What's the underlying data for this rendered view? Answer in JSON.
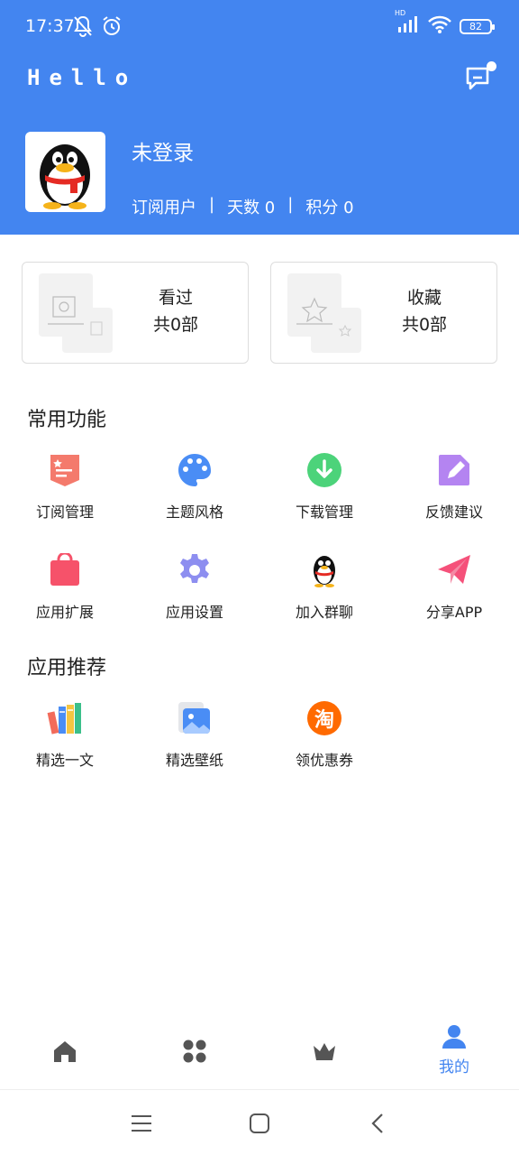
{
  "status_bar": {
    "time": "17:37",
    "network_badge": "HD",
    "battery": "82",
    "icons": [
      "mute-icon",
      "alarm-icon",
      "signal-icon",
      "wifi-icon",
      "battery-icon"
    ]
  },
  "header": {
    "app_title": "Hello",
    "message_icon": "message-icon",
    "bg_color": "#4385f0"
  },
  "user": {
    "name": "未登录",
    "subscription": "订阅用户",
    "separator": "|",
    "days": "天数 0",
    "points": "积分 0"
  },
  "cards": [
    {
      "title": "看过",
      "count": "共0部",
      "icon": "history-illustration"
    },
    {
      "title": "收藏",
      "count": "共0部",
      "icon": "favorite-illustration"
    }
  ],
  "common_functions": {
    "title": "常用功能",
    "items": [
      {
        "label": "订阅管理",
        "icon": "subscription-icon",
        "color": "#f47a6c"
      },
      {
        "label": "主题风格",
        "icon": "palette-icon",
        "color": "#4a8df5"
      },
      {
        "label": "下载管理",
        "icon": "download-icon",
        "color": "#4cd37a"
      },
      {
        "label": "反馈建议",
        "icon": "edit-icon",
        "color": "#b484f1"
      },
      {
        "label": "应用扩展",
        "icon": "shopping-bag-icon",
        "color": "#f6526a"
      },
      {
        "label": "应用设置",
        "icon": "gear-icon",
        "color": "#8d8ef0"
      },
      {
        "label": "加入群聊",
        "icon": "qq-penguin-icon",
        "color": "#000000"
      },
      {
        "label": "分享APP",
        "icon": "paper-plane-icon",
        "color": "#f5517a"
      }
    ]
  },
  "recommended_apps": {
    "title": "应用推荐",
    "items": [
      {
        "label": "精选一文",
        "icon": "books-icon"
      },
      {
        "label": "精选壁纸",
        "icon": "wallpaper-icon"
      },
      {
        "label": "领优惠券",
        "icon": "taobao-icon",
        "badge": "淘"
      }
    ]
  },
  "tabbar": {
    "tabs": [
      {
        "icon": "home-icon",
        "label": ""
      },
      {
        "icon": "apps-grid-icon",
        "label": ""
      },
      {
        "icon": "crown-icon",
        "label": ""
      },
      {
        "icon": "user-icon",
        "label": "我的",
        "active": true
      }
    ],
    "active_color": "#4385f0",
    "inactive_color": "#555555"
  },
  "system_nav": {
    "buttons": [
      "menu-icon",
      "home-square-icon",
      "back-icon"
    ]
  }
}
